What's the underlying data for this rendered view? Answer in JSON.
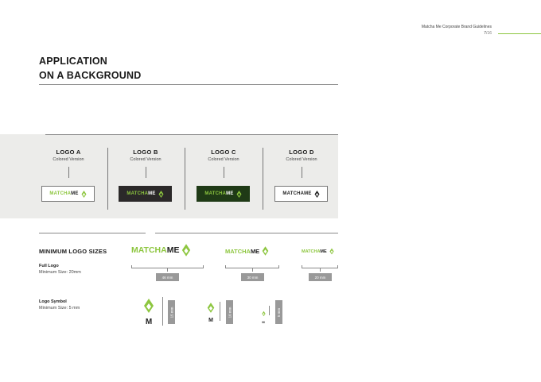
{
  "header": {
    "doc_title": "Matcha Me Corporate Brand Guidelines",
    "page_current": "7",
    "page_sep": "/",
    "page_total": "16"
  },
  "page": {
    "title_line1": "APPLICATION",
    "title_line2": "ON A BACKGROUND"
  },
  "logos": [
    {
      "name": "LOGO A",
      "subtitle": "Colored Version",
      "bg": "#ffffff",
      "word1_color": "#8dc63f",
      "word2_color": "#1e1e1e",
      "leaf_color": "#8dc63f"
    },
    {
      "name": "LOGO B",
      "subtitle": "Colored Version",
      "bg": "#2b2929",
      "word1_color": "#8dc63f",
      "word2_color": "#ffffff",
      "leaf_color": "#8dc63f"
    },
    {
      "name": "LOGO C",
      "subtitle": "Colored Version",
      "bg": "#1f3a16",
      "word1_color": "#8dc63f",
      "word2_color": "#ffffff",
      "leaf_color": "#8dc63f"
    },
    {
      "name": "LOGO D",
      "subtitle": "Colored Version",
      "bg": "#ffffff",
      "word1_color": "#1e1e1e",
      "word2_color": "#1e1e1e",
      "leaf_color": "#1e1e1e"
    }
  ],
  "brand": {
    "word1": "MATCHA",
    "word2": "ME",
    "accent": "#8dc63f",
    "dark": "#1e1e1e"
  },
  "minimum": {
    "title": "MINIMUM LOGO SIZES",
    "full_logo_label": "Full Logo",
    "full_logo_min": "Minimum Size: 20mm",
    "symbol_label": "Logo Symbol",
    "symbol_min": "Minimum Size: 5 mm",
    "full_sizes": [
      "46 mm",
      "30 mm",
      "20 mm"
    ],
    "symbol_sizes": [
      "15 mm",
      "10 mm",
      "5 mm"
    ],
    "symbol_letter": "M"
  }
}
